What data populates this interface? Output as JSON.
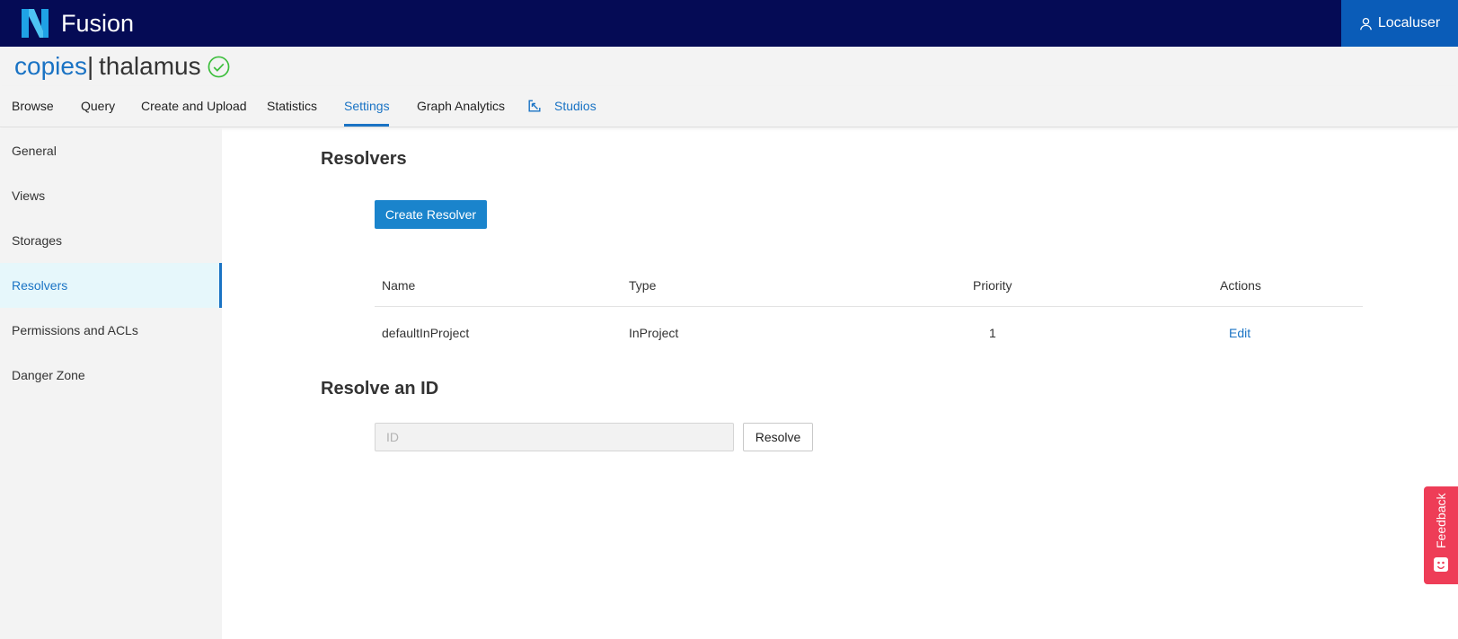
{
  "app": {
    "title": "Fusion"
  },
  "user": {
    "label": "Localuser"
  },
  "project": {
    "org": "copies",
    "separator": "|",
    "name": "thalamus"
  },
  "tabs": [
    {
      "label": "Browse"
    },
    {
      "label": "Query"
    },
    {
      "label": "Create and Upload"
    },
    {
      "label": "Statistics"
    },
    {
      "label": "Settings"
    },
    {
      "label": "Graph Analytics"
    },
    {
      "label": "Studios"
    }
  ],
  "active_tab": "Settings",
  "sidebar": {
    "items": [
      {
        "label": "General"
      },
      {
        "label": "Views"
      },
      {
        "label": "Storages"
      },
      {
        "label": "Resolvers"
      },
      {
        "label": "Permissions and ACLs"
      },
      {
        "label": "Danger Zone"
      }
    ],
    "active": "Resolvers"
  },
  "resolvers": {
    "heading": "Resolvers",
    "create_button": "Create Resolver",
    "columns": [
      "Name",
      "Type",
      "Priority",
      "Actions"
    ],
    "rows": [
      {
        "name": "defaultInProject",
        "type": "InProject",
        "priority": "1",
        "action": "Edit"
      }
    ]
  },
  "resolve_id": {
    "heading": "Resolve an ID",
    "placeholder": "ID",
    "value": "",
    "button": "Resolve"
  },
  "feedback": {
    "label": "Feedback"
  },
  "colors": {
    "topbar": "#050b55",
    "accent": "#1a73c4",
    "primary_button": "#1a84cc",
    "feedback": "#ee3d57",
    "status_ok": "#3cbe3c"
  },
  "icons": {
    "logo": "nexus-logo-icon",
    "user": "user-icon",
    "status": "check-circle-icon",
    "studios": "studio-link-icon",
    "feedback": "smile-icon"
  }
}
